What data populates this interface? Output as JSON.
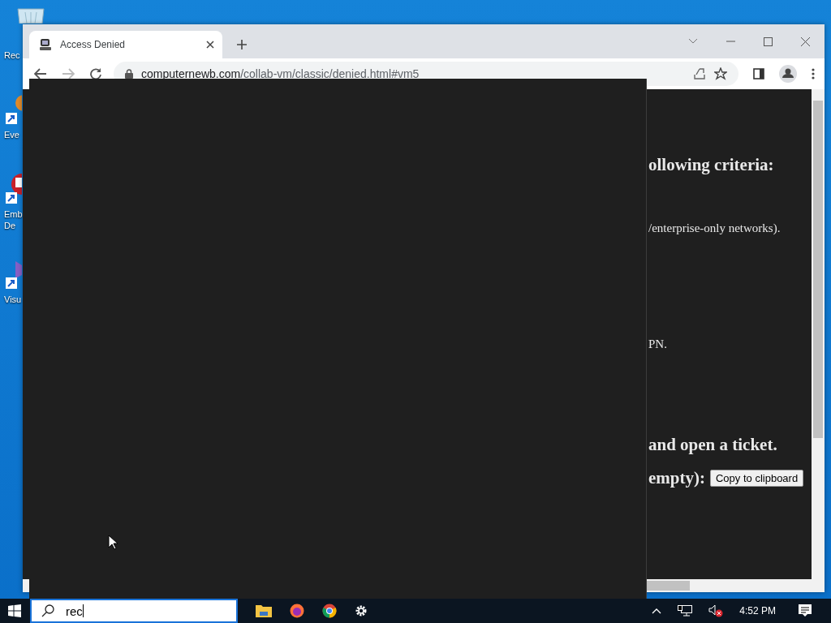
{
  "desktop_icons": [
    {
      "kind": "bin",
      "lines": [
        "Rec"
      ]
    },
    {
      "kind": "event",
      "lines": [
        "Eve"
      ]
    },
    {
      "kind": "red",
      "lines": [
        "Emb",
        "De"
      ]
    },
    {
      "kind": "visual",
      "lines": [
        "Visu"
      ]
    }
  ],
  "browser": {
    "tab": {
      "title": "Access Denied",
      "selected": true
    },
    "address": {
      "host": "computernewb.com",
      "path": "/collab-vm/classic/denied.html#vm5"
    },
    "page": {
      "lines": [
        {
          "kind": "heading",
          "text": "ollowing criteria:"
        },
        {
          "kind": "text",
          "text": "/enterprise-only networks)."
        },
        {
          "kind": "text",
          "text": "PN."
        },
        {
          "kind": "heading",
          "text": "and open a ticket."
        },
        {
          "kind": "heading",
          "text": "empty):"
        }
      ],
      "button": "Copy to clipboard"
    }
  },
  "taskbar": {
    "search": {
      "value": "rec"
    },
    "clock": "4:52 PM"
  }
}
